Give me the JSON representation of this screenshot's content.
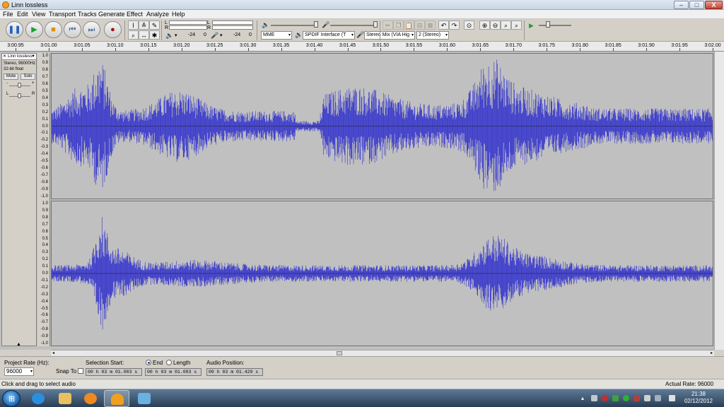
{
  "window": {
    "title": "Linn lossless",
    "min_glyph": "–",
    "max_glyph": "□",
    "close_glyph": "X"
  },
  "menu": [
    "File",
    "Edit",
    "View",
    "Transport",
    "Tracks",
    "Generate",
    "Effect",
    "Analyze",
    "Help"
  ],
  "toolbar": {
    "meter_left_label": "L",
    "meter_right_label": "R",
    "meter_ticks": [
      "-24",
      "0"
    ],
    "meter2_ticks": [
      "-24",
      "0"
    ],
    "host": "MME",
    "output_device": "SPDIF Interface (T",
    "input_device": "Stereo Mix (VIA Hig",
    "channels": "2 (Stereo)"
  },
  "ruler": {
    "ticks": [
      "3:00.95",
      "3:01.00",
      "3:01.05",
      "3:01.10",
      "3:01.15",
      "3:01.20",
      "3:01.25",
      "3:01.30",
      "3:01.35",
      "3:01.40",
      "3:01.45",
      "3:01.50",
      "3:01.55",
      "3:01.60",
      "3:01.65",
      "3:01.70",
      "3:01.75",
      "3:01.80",
      "3:01.85",
      "3:01.90",
      "3:01.95",
      "3:02.00"
    ]
  },
  "track": {
    "name": "Linn lossless",
    "info_line1": "Stereo, 96000Hz",
    "info_line2": "32-bit float",
    "mute_label": "Mute",
    "solo_label": "Solo",
    "gain_minus": "-",
    "gain_plus": "+",
    "pan_left": "L",
    "pan_right": "R",
    "collapse_glyph": "▲",
    "wave_color": "#3333cc",
    "yaxis_labels": [
      "1.0",
      "0.9",
      "0.8",
      "0.7",
      "0.6",
      "0.5",
      "0.4",
      "0.3",
      "0.2",
      "0.1",
      "0.0",
      "-0.1",
      "-0.2",
      "-0.3",
      "-0.4",
      "-0.5",
      "-0.6",
      "-0.7",
      "-0.8",
      "-0.9",
      "-1.0"
    ]
  },
  "selection_bar": {
    "project_rate_label": "Project Rate (Hz):",
    "project_rate": "96000",
    "snap_to_label": "Snap To",
    "selection_start_label": "Selection Start:",
    "selection_start": "00 h 03 m 01.003 s",
    "end_label": "End",
    "length_label": "Length",
    "end_value": "00 h 03 m 01.003 s",
    "audio_position_label": "Audio Position:",
    "audio_position": "00 h 03 m 01.429 s"
  },
  "status": {
    "left": "Click and drag to select audio",
    "right": "Actual Rate: 96000"
  },
  "taskbar": {
    "time": "21:38",
    "date": "02/12/2012"
  }
}
